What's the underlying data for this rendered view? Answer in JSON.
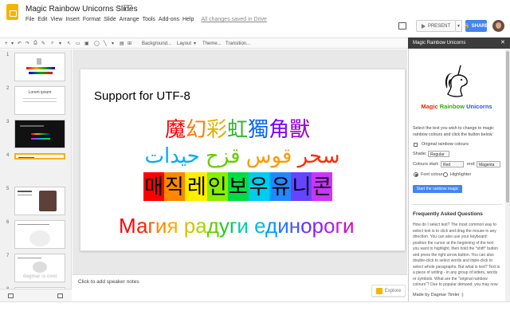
{
  "app": {
    "title": "Magic Rainbow Unicorns Slides",
    "menus": [
      "File",
      "Edit",
      "View",
      "Insert",
      "Format",
      "Slide",
      "Arrange",
      "Tools",
      "Add-ons",
      "Help"
    ],
    "saved_status": "All changes saved in Drive",
    "present_label": "PRESENT",
    "share_label": "SHARE"
  },
  "toolbar": {
    "background_label": "Background...",
    "layout_label": "Layout",
    "theme_label": "Theme...",
    "transition_label": "Transition..."
  },
  "filmstrip": {
    "numbers": [
      "1",
      "2",
      "3",
      "4",
      "5",
      "6",
      "7",
      "8"
    ],
    "thumb2_text": "Lorem ipsum",
    "thumb7_text": "dagmar is cool"
  },
  "slide": {
    "title": "Support for UTF-8",
    "cjk": [
      {
        "text": "魔",
        "color": "#ff0000"
      },
      {
        "text": "幻",
        "color": "#ff7a00"
      },
      {
        "text": "彩",
        "color": "#e0b000"
      },
      {
        "text": "虹",
        "color": "#2db82d"
      },
      {
        "text": "獨",
        "color": "#0066ff"
      },
      {
        "text": "角",
        "color": "#7a00ff"
      },
      {
        "text": "獸",
        "color": "#9900cc"
      }
    ],
    "arabic": [
      {
        "text": "سحر",
        "color": "#ff2a00"
      },
      {
        "text": " ",
        "color": "#000"
      },
      {
        "text": "قوس",
        "color": "#ff9900"
      },
      {
        "text": " ",
        "color": "#000"
      },
      {
        "text": "قزح",
        "color": "#66cc00"
      },
      {
        "text": " ",
        "color": "#000"
      },
      {
        "text": "حيدات",
        "color": "#00aaff"
      }
    ],
    "korean": [
      {
        "text": "매",
        "bg": "#ff0000"
      },
      {
        "text": "직",
        "bg": "#ff8800"
      },
      {
        "text": " ",
        "bg": "#ffee00"
      },
      {
        "text": "레",
        "bg": "#ffee00"
      },
      {
        "text": "인",
        "bg": "#88ee00"
      },
      {
        "text": "보",
        "bg": "#00dd44"
      },
      {
        "text": "우",
        "bg": "#00ccee"
      },
      {
        "text": " ",
        "bg": "#00aaff"
      },
      {
        "text": "유",
        "bg": "#2288ff"
      },
      {
        "text": "니",
        "bg": "#6644ff"
      },
      {
        "text": "콘",
        "bg": "#cc33ff"
      }
    ],
    "russian": [
      {
        "text": "М",
        "color": "#ff0000"
      },
      {
        "text": "а",
        "color": "#ff2200"
      },
      {
        "text": "г",
        "color": "#ff5500"
      },
      {
        "text": "и",
        "color": "#ff8800"
      },
      {
        "text": "я",
        "color": "#ffaa00"
      },
      {
        "text": " ",
        "color": "#000"
      },
      {
        "text": "р",
        "color": "#d4c200"
      },
      {
        "text": "а",
        "color": "#a6d600"
      },
      {
        "text": "д",
        "color": "#66cc00"
      },
      {
        "text": "у",
        "color": "#22cc22"
      },
      {
        "text": "г",
        "color": "#00cc66"
      },
      {
        "text": "и",
        "color": "#00ccaa"
      },
      {
        "text": " ",
        "color": "#000"
      },
      {
        "text": "е",
        "color": "#00bbdd"
      },
      {
        "text": "д",
        "color": "#0099ff"
      },
      {
        "text": "и",
        "color": "#2277ff"
      },
      {
        "text": "н",
        "color": "#4455ff"
      },
      {
        "text": "о",
        "color": "#6633ff"
      },
      {
        "text": "р",
        "color": "#8822ff"
      },
      {
        "text": "о",
        "color": "#aa22ee"
      },
      {
        "text": "г",
        "color": "#cc11dd"
      },
      {
        "text": "и",
        "color": "#dd00cc"
      }
    ]
  },
  "notes": {
    "placeholder": "Click to add speaker notes",
    "explore_label": "Explore"
  },
  "sidebar": {
    "header": "Magic Rainbow Unicorns",
    "brand": [
      {
        "text": "Magic ",
        "color": "#ff2200"
      },
      {
        "text": "Rainbow ",
        "color": "#33aa00"
      },
      {
        "text": "Unicorns",
        "color": "#2255ff"
      }
    ],
    "instructions": "Select the text you wish to change to magic rainbow colours and click the button below.",
    "original_colours_label": "Original rainbow colours",
    "shade_label": "Shade:",
    "shade_value": "Regular",
    "colours_start_label": "Colours start:",
    "start_value": "Red",
    "end_label": "end:",
    "end_value": "Magenta",
    "font_colour_label": "Font colour",
    "highlighter_label": "Highlighter",
    "button_label": "Start the rainbow magic",
    "faq_title": "Frequently Asked Questions",
    "faq_text": "How do I select text? The most common way to select text is to click and drag the mouse in any direction. You can also use your keyboard: position the cursor at the beginning of the text you want to highlight, then hold the *shift* button and press the right arrow button. You can also double-click to select words and triple-click to select whole paragraphs. But what is text? Text is a piece of writing - in any group of letters, words or symbols. What are the \"original rainbow colours\"? Due to popular demand, you may now select the original",
    "made_by": "Made by Dagmar Timler :)"
  }
}
